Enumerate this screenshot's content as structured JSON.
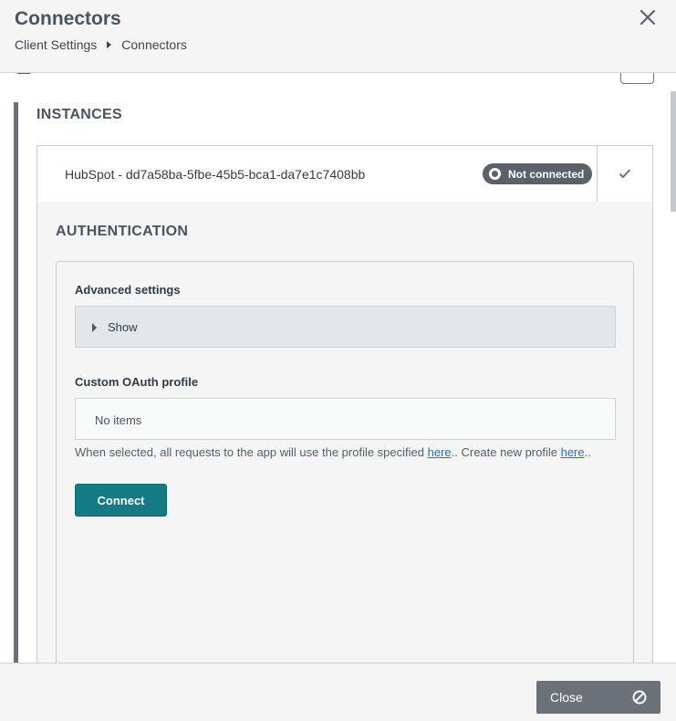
{
  "header": {
    "title": "Connectors",
    "breadcrumb": [
      "Client Settings",
      "Connectors"
    ]
  },
  "instances": {
    "title": "INSTANCES",
    "items": [
      {
        "name": "HubSpot - dd7a58ba-5fbe-45b5-bca1-da7e1c7408bb",
        "status": "Not connected"
      }
    ]
  },
  "authentication": {
    "title": "AUTHENTICATION",
    "advanced_settings_label": "Advanced settings",
    "show_label": "Show",
    "custom_oauth_label": "Custom OAuth profile",
    "custom_oauth_value": "No items",
    "help_text_1": "When selected, all requests to the app will use the profile specified ",
    "help_link_1": "here",
    "help_text_2": ".. Create new profile ",
    "help_link_2": "here",
    "help_text_3": "..",
    "connect_label": "Connect"
  },
  "footer": {
    "close_label": "Close"
  },
  "colors": {
    "accent": "#147a84",
    "status_badge": "#5b6168",
    "link": "#2a73b8"
  }
}
